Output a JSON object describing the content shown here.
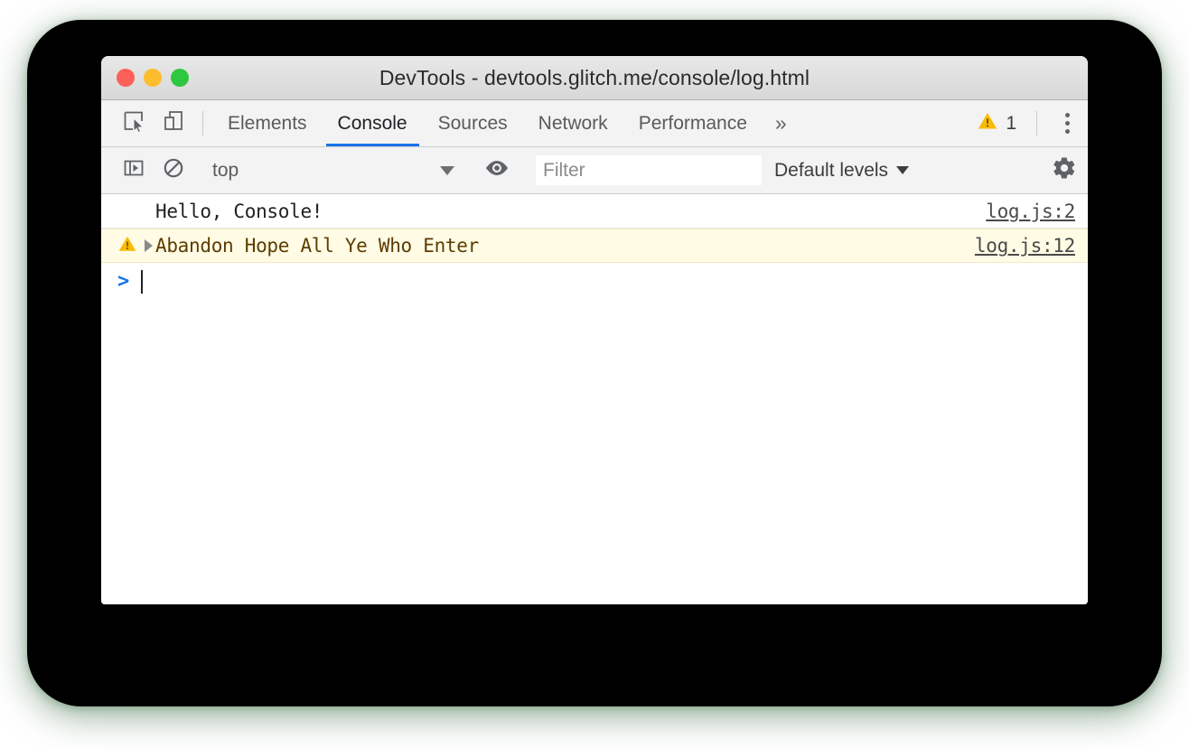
{
  "window": {
    "title": "DevTools - devtools.glitch.me/console/log.html",
    "traffic_lights": [
      {
        "name": "close",
        "color": "#fc6058"
      },
      {
        "name": "minimize",
        "color": "#fdbc2d"
      },
      {
        "name": "zoom",
        "color": "#2ec840"
      }
    ]
  },
  "tabbar": {
    "inspect_icon": "inspect-element-icon",
    "device_icon": "device-toolbar-icon",
    "tabs": [
      {
        "label": "Elements",
        "active": false
      },
      {
        "label": "Console",
        "active": true
      },
      {
        "label": "Sources",
        "active": false
      },
      {
        "label": "Network",
        "active": false
      },
      {
        "label": "Performance",
        "active": false
      }
    ],
    "more_tabs_label": "»",
    "warning_icon": "warning-triangle-icon",
    "warning_count": "1",
    "menu_icon": "kebab-menu-icon",
    "accent_color": "#1a73e8",
    "warning_color": "#fabb05"
  },
  "filterbar": {
    "sidebar_toggle_icon": "console-sidebar-icon",
    "clear_console_icon": "clear-console-icon",
    "context": {
      "value": "top",
      "caret": "chevron-down-icon"
    },
    "live_expression_icon": "eye-icon",
    "filter": {
      "value": "",
      "placeholder": "Filter"
    },
    "levels": {
      "value": "Default levels",
      "caret": "chevron-down-icon"
    },
    "settings_icon": "gear-icon"
  },
  "console": {
    "messages": [
      {
        "level": "log",
        "icon": "",
        "expandable": false,
        "text": "Hello, Console!",
        "source": "log.js:2"
      },
      {
        "level": "warning",
        "icon": "warning-triangle-icon",
        "expandable": true,
        "text": "Abandon Hope All Ye Who Enter",
        "source": "log.js:12"
      }
    ],
    "prompt": {
      "chevron": ">",
      "value": ""
    },
    "warning_bg": "#fffbe5",
    "warning_text_color": "#5c3c00"
  }
}
